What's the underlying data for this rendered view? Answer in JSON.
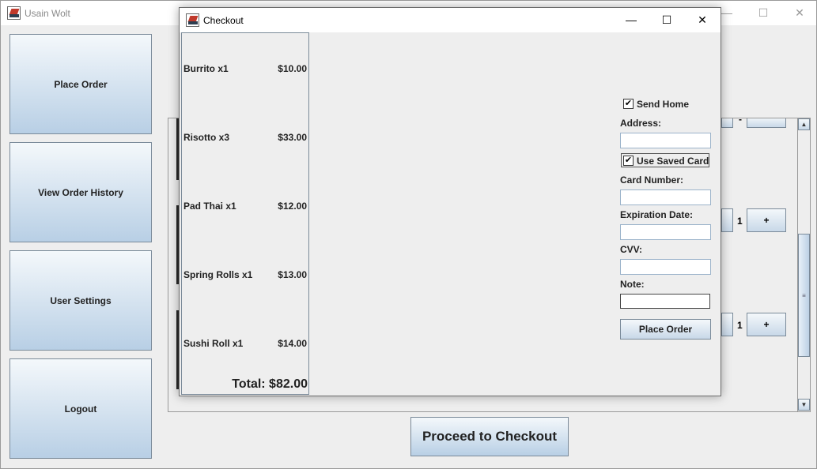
{
  "main_window": {
    "title": "Usain Wolt",
    "controls": {
      "minimize": "—",
      "maximize": "☐",
      "close": "✕"
    }
  },
  "sidebar": {
    "place_order": "Place Order",
    "view_order_history": "View Order History",
    "user_settings": "User Settings",
    "logout": "Logout"
  },
  "menu_panel": {
    "rows": [
      {
        "qty": "1",
        "plus": "+"
      },
      {
        "qty": "1",
        "plus": "+"
      }
    ],
    "top_partial_label": "-"
  },
  "proceed_button": "Proceed to Checkout",
  "checkout": {
    "title": "Checkout",
    "controls": {
      "minimize": "—",
      "maximize": "☐",
      "close": "✕"
    },
    "items": [
      {
        "name": "Burrito x1",
        "price": "$10.00"
      },
      {
        "name": "Risotto x3",
        "price": "$33.00"
      },
      {
        "name": "Pad Thai x1",
        "price": "$12.00"
      },
      {
        "name": "Spring Rolls x1",
        "price": "$13.00"
      },
      {
        "name": "Sushi Roll x1",
        "price": "$14.00"
      }
    ],
    "total": "Total: $82.00",
    "form": {
      "send_home_label": "Send Home",
      "send_home_checked": true,
      "address_label": "Address:",
      "address_value": "",
      "use_saved_card_label": "Use Saved Card",
      "use_saved_card_checked": true,
      "card_number_label": "Card Number:",
      "card_number_value": "",
      "expiration_label": "Expiration Date:",
      "expiration_value": "",
      "cvv_label": "CVV:",
      "cvv_value": "",
      "note_label": "Note:",
      "note_value": "",
      "place_order_button": "Place Order",
      "check_mark": "✔"
    }
  }
}
